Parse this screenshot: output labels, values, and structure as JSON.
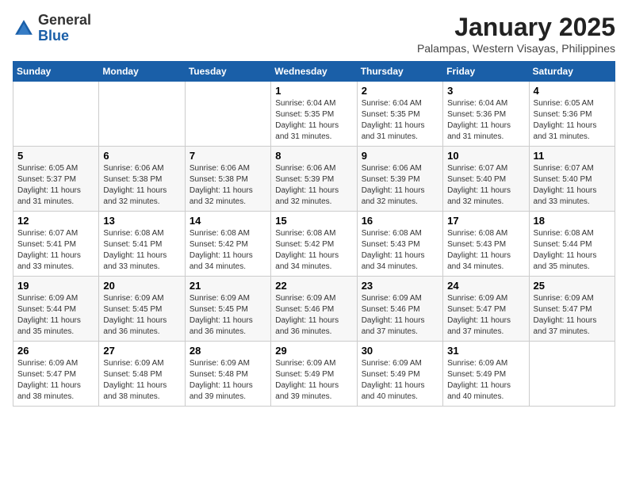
{
  "header": {
    "logo": {
      "line1": "General",
      "line2": "Blue"
    },
    "title": "January 2025",
    "subtitle": "Palampas, Western Visayas, Philippines"
  },
  "days_of_week": [
    "Sunday",
    "Monday",
    "Tuesday",
    "Wednesday",
    "Thursday",
    "Friday",
    "Saturday"
  ],
  "weeks": [
    [
      {
        "day": "",
        "info": ""
      },
      {
        "day": "",
        "info": ""
      },
      {
        "day": "",
        "info": ""
      },
      {
        "day": "1",
        "info": "Sunrise: 6:04 AM\nSunset: 5:35 PM\nDaylight: 11 hours\nand 31 minutes."
      },
      {
        "day": "2",
        "info": "Sunrise: 6:04 AM\nSunset: 5:35 PM\nDaylight: 11 hours\nand 31 minutes."
      },
      {
        "day": "3",
        "info": "Sunrise: 6:04 AM\nSunset: 5:36 PM\nDaylight: 11 hours\nand 31 minutes."
      },
      {
        "day": "4",
        "info": "Sunrise: 6:05 AM\nSunset: 5:36 PM\nDaylight: 11 hours\nand 31 minutes."
      }
    ],
    [
      {
        "day": "5",
        "info": "Sunrise: 6:05 AM\nSunset: 5:37 PM\nDaylight: 11 hours\nand 31 minutes."
      },
      {
        "day": "6",
        "info": "Sunrise: 6:06 AM\nSunset: 5:38 PM\nDaylight: 11 hours\nand 32 minutes."
      },
      {
        "day": "7",
        "info": "Sunrise: 6:06 AM\nSunset: 5:38 PM\nDaylight: 11 hours\nand 32 minutes."
      },
      {
        "day": "8",
        "info": "Sunrise: 6:06 AM\nSunset: 5:39 PM\nDaylight: 11 hours\nand 32 minutes."
      },
      {
        "day": "9",
        "info": "Sunrise: 6:06 AM\nSunset: 5:39 PM\nDaylight: 11 hours\nand 32 minutes."
      },
      {
        "day": "10",
        "info": "Sunrise: 6:07 AM\nSunset: 5:40 PM\nDaylight: 11 hours\nand 32 minutes."
      },
      {
        "day": "11",
        "info": "Sunrise: 6:07 AM\nSunset: 5:40 PM\nDaylight: 11 hours\nand 33 minutes."
      }
    ],
    [
      {
        "day": "12",
        "info": "Sunrise: 6:07 AM\nSunset: 5:41 PM\nDaylight: 11 hours\nand 33 minutes."
      },
      {
        "day": "13",
        "info": "Sunrise: 6:08 AM\nSunset: 5:41 PM\nDaylight: 11 hours\nand 33 minutes."
      },
      {
        "day": "14",
        "info": "Sunrise: 6:08 AM\nSunset: 5:42 PM\nDaylight: 11 hours\nand 34 minutes."
      },
      {
        "day": "15",
        "info": "Sunrise: 6:08 AM\nSunset: 5:42 PM\nDaylight: 11 hours\nand 34 minutes."
      },
      {
        "day": "16",
        "info": "Sunrise: 6:08 AM\nSunset: 5:43 PM\nDaylight: 11 hours\nand 34 minutes."
      },
      {
        "day": "17",
        "info": "Sunrise: 6:08 AM\nSunset: 5:43 PM\nDaylight: 11 hours\nand 34 minutes."
      },
      {
        "day": "18",
        "info": "Sunrise: 6:08 AM\nSunset: 5:44 PM\nDaylight: 11 hours\nand 35 minutes."
      }
    ],
    [
      {
        "day": "19",
        "info": "Sunrise: 6:09 AM\nSunset: 5:44 PM\nDaylight: 11 hours\nand 35 minutes."
      },
      {
        "day": "20",
        "info": "Sunrise: 6:09 AM\nSunset: 5:45 PM\nDaylight: 11 hours\nand 36 minutes."
      },
      {
        "day": "21",
        "info": "Sunrise: 6:09 AM\nSunset: 5:45 PM\nDaylight: 11 hours\nand 36 minutes."
      },
      {
        "day": "22",
        "info": "Sunrise: 6:09 AM\nSunset: 5:46 PM\nDaylight: 11 hours\nand 36 minutes."
      },
      {
        "day": "23",
        "info": "Sunrise: 6:09 AM\nSunset: 5:46 PM\nDaylight: 11 hours\nand 37 minutes."
      },
      {
        "day": "24",
        "info": "Sunrise: 6:09 AM\nSunset: 5:47 PM\nDaylight: 11 hours\nand 37 minutes."
      },
      {
        "day": "25",
        "info": "Sunrise: 6:09 AM\nSunset: 5:47 PM\nDaylight: 11 hours\nand 37 minutes."
      }
    ],
    [
      {
        "day": "26",
        "info": "Sunrise: 6:09 AM\nSunset: 5:47 PM\nDaylight: 11 hours\nand 38 minutes."
      },
      {
        "day": "27",
        "info": "Sunrise: 6:09 AM\nSunset: 5:48 PM\nDaylight: 11 hours\nand 38 minutes."
      },
      {
        "day": "28",
        "info": "Sunrise: 6:09 AM\nSunset: 5:48 PM\nDaylight: 11 hours\nand 39 minutes."
      },
      {
        "day": "29",
        "info": "Sunrise: 6:09 AM\nSunset: 5:49 PM\nDaylight: 11 hours\nand 39 minutes."
      },
      {
        "day": "30",
        "info": "Sunrise: 6:09 AM\nSunset: 5:49 PM\nDaylight: 11 hours\nand 40 minutes."
      },
      {
        "day": "31",
        "info": "Sunrise: 6:09 AM\nSunset: 5:49 PM\nDaylight: 11 hours\nand 40 minutes."
      },
      {
        "day": "",
        "info": ""
      }
    ]
  ]
}
